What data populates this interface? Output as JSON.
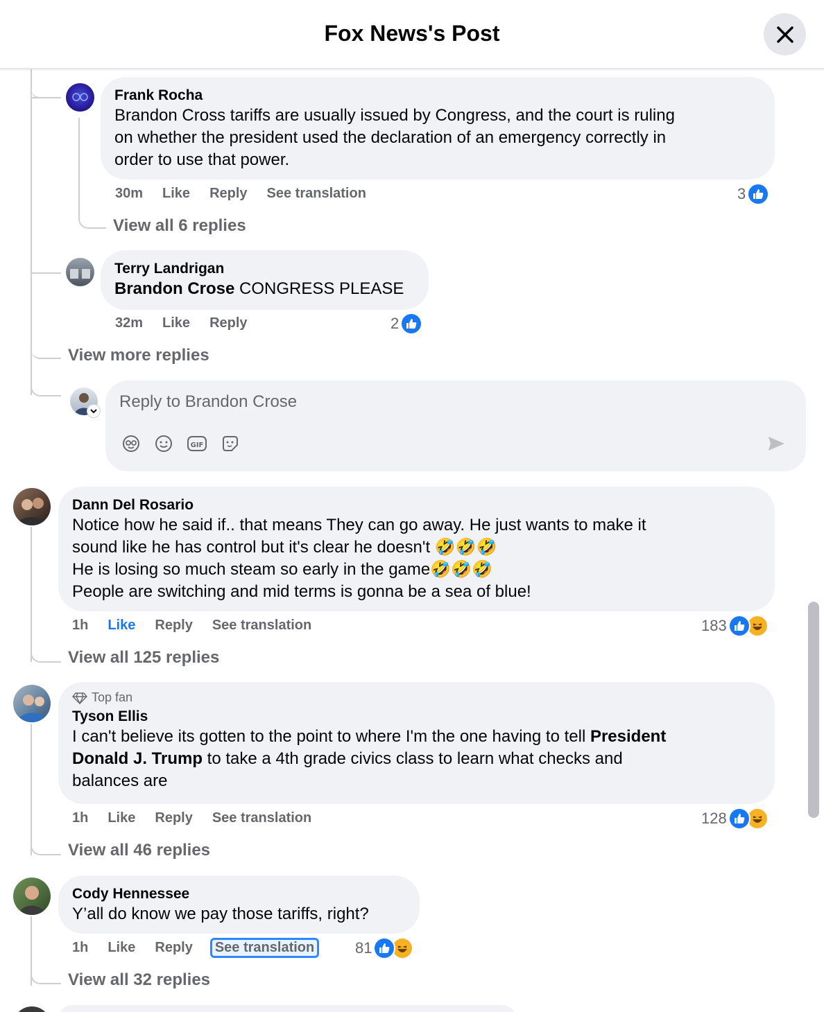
{
  "header": {
    "title": "Fox News's Post"
  },
  "comments": [
    {
      "author": "Frank Rocha",
      "lines": [
        "Brandon Cross tariffs are usually issued by Congress, and the court is ruling",
        "on whether the president used the declaration of an emergency correctly in",
        "order to use that power."
      ],
      "time": "30m",
      "like": "Like",
      "reply": "Reply",
      "translate": "See translation",
      "reactions": "3",
      "view_replies": "View all 6 replies"
    },
    {
      "author": "Terry Landrigan",
      "mention": "Brandon Crose",
      "text": " CONGRESS PLEASE",
      "time": "32m",
      "like": "Like",
      "reply": "Reply",
      "reactions": "2"
    },
    {
      "author": "Dann Del Rosario",
      "lines": [
        "Notice how he said if.. that means They can go away. He just wants to make it",
        "sound like he has control but it's clear he doesn't",
        "He is losing so much steam so early in the game",
        "People are switching and mid terms is gonna be a sea of blue!"
      ],
      "time": "1h",
      "like": "Like",
      "reply": "Reply",
      "translate": "See translation",
      "reactions": "183",
      "view_replies": "View all 125 replies"
    },
    {
      "badge": "Top fan",
      "author": "Tyson Ellis",
      "line1_pre": "I can't believe its gotten to the point to where I'm the one having to tell ",
      "line1_bold": "President",
      "line2_bold": "Donald J. Trump",
      "line2_post": " to take a 4th grade civics class to learn what checks and",
      "line3": "balances are",
      "time": "1h",
      "like": "Like",
      "reply": "Reply",
      "translate": "See translation",
      "reactions": "128",
      "view_replies": "View all 46 replies"
    },
    {
      "author": "Cody Hennessee",
      "text": "Y’all do know we pay those tariffs, right?",
      "time": "1h",
      "like": "Like",
      "reply": "Reply",
      "translate": "See translation",
      "reactions": "81",
      "view_replies": "View all 32 replies"
    }
  ],
  "view_more_replies": "View more replies",
  "reply_box": {
    "placeholder": "Reply to Brandon Crose"
  },
  "icons": {
    "close": "close-icon",
    "like": "like-reaction-icon",
    "haha": "haha-reaction-icon",
    "avatar_sticker": "avatar-sticker-icon",
    "emoji": "emoji-icon",
    "gif": "gif-icon",
    "sticker": "sticker-icon",
    "send": "send-icon",
    "top_fan": "diamond-icon"
  },
  "colors": {
    "accent": "#1877f2",
    "bubble": "#f0f2f5",
    "muted": "#65676b",
    "haha": "#f7b125"
  }
}
